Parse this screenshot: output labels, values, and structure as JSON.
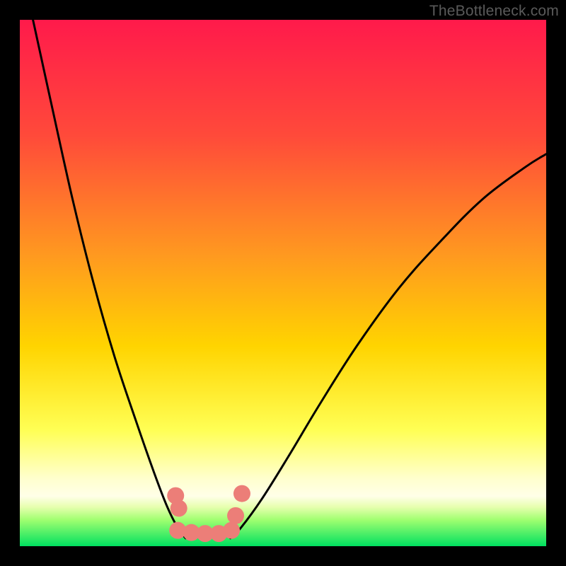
{
  "watermark": "TheBottleneck.com",
  "chart_data": {
    "type": "line",
    "title": "",
    "xlabel": "",
    "ylabel": "",
    "xlim": [
      0,
      1
    ],
    "ylim": [
      0,
      1
    ],
    "background_gradient": {
      "top": "#ff1a4b",
      "mid_upper": "#ff7a2a",
      "mid": "#ffd400",
      "mid_lower": "#ffff66",
      "band": "#ffffcc",
      "bottom": "#00e060"
    },
    "curves": [
      {
        "name": "left-arm",
        "x": [
          0.025,
          0.06,
          0.1,
          0.14,
          0.18,
          0.22,
          0.255,
          0.28,
          0.3,
          0.315
        ],
        "y": [
          1.0,
          0.84,
          0.66,
          0.5,
          0.36,
          0.24,
          0.14,
          0.075,
          0.035,
          0.015
        ],
        "stroke": "#000000",
        "width": 3
      },
      {
        "name": "right-arm",
        "x": [
          0.4,
          0.42,
          0.46,
          0.51,
          0.57,
          0.64,
          0.72,
          0.8,
          0.88,
          0.96,
          1.0
        ],
        "y": [
          0.015,
          0.035,
          0.09,
          0.17,
          0.27,
          0.38,
          0.49,
          0.58,
          0.66,
          0.72,
          0.745
        ],
        "stroke": "#000000",
        "width": 3
      }
    ],
    "bottom_marker": {
      "name": "valley-dots",
      "color": "#ec7e78",
      "radius": 12,
      "points": [
        {
          "x": 0.296,
          "y": 0.096
        },
        {
          "x": 0.302,
          "y": 0.072
        },
        {
          "x": 0.3,
          "y": 0.03
        },
        {
          "x": 0.326,
          "y": 0.026
        },
        {
          "x": 0.352,
          "y": 0.024
        },
        {
          "x": 0.378,
          "y": 0.024
        },
        {
          "x": 0.402,
          "y": 0.03
        },
        {
          "x": 0.41,
          "y": 0.058
        },
        {
          "x": 0.422,
          "y": 0.1
        }
      ]
    }
  }
}
